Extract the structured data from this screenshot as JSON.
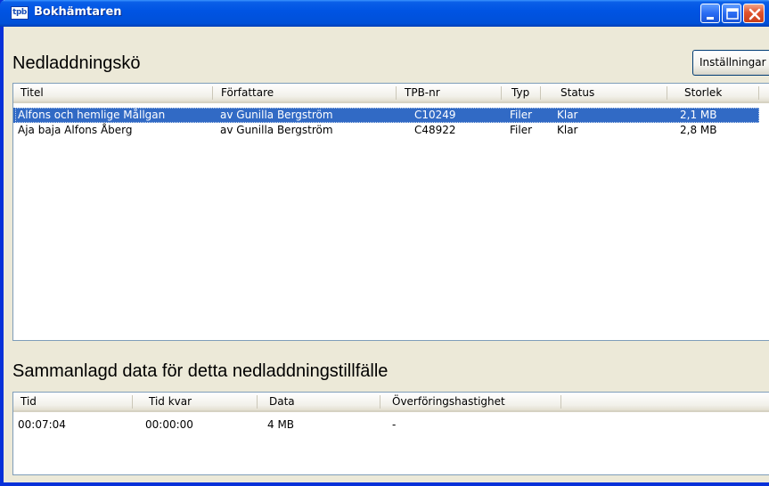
{
  "window": {
    "title": "Bokhämtaren",
    "icon_label": "tpb",
    "controls": [
      "minimize-icon",
      "maximize-icon",
      "close-icon"
    ]
  },
  "queue": {
    "heading": "Nedladdningskö",
    "settings_label": "Inställningar",
    "columns": [
      "Titel",
      "Författare",
      "TPB-nr",
      "Typ",
      "Status",
      "Storlek"
    ],
    "rows": [
      {
        "titel": "Alfons och hemlige Mållgan",
        "forfattare": "av Gunilla Bergström",
        "tpb": "C10249",
        "typ": "Filer",
        "status": "Klar",
        "storlek": "2,1 MB",
        "selected": true
      },
      {
        "titel": "Aja baja Alfons Åberg",
        "forfattare": "av Gunilla Bergström",
        "tpb": "C48922",
        "typ": "Filer",
        "status": "Klar",
        "storlek": "2,8 MB",
        "selected": false
      }
    ]
  },
  "summary": {
    "heading": "Sammanlagd data för detta nedladdningstillfälle",
    "columns": [
      "Tid",
      "Tid kvar",
      "Data",
      "Överföringshastighet"
    ],
    "rows": [
      {
        "tid": "00:07:04",
        "tid_kvar": "00:00:00",
        "data": "4 MB",
        "hastighet": "-"
      }
    ]
  },
  "colors": {
    "selection": "#316ac5",
    "titlebar": "#0054e3",
    "window_bg": "#ece9d8"
  }
}
